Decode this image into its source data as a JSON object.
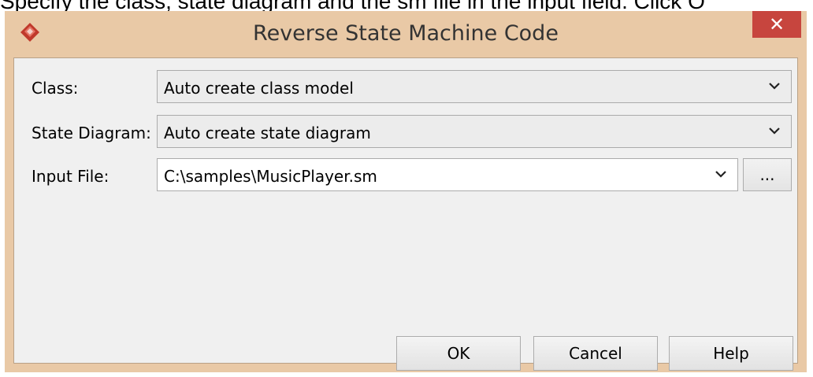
{
  "caption": "Specify the class, state diagram and the sm file in the input field. Click O",
  "window": {
    "title": "Reverse State Machine Code",
    "close_icon": "close-icon",
    "app_icon": "visual-paradigm-logo-icon"
  },
  "form": {
    "class_label": "Class:",
    "class_value": "Auto create class model",
    "state_diagram_label": "State Diagram:",
    "state_diagram_value": "Auto create state diagram",
    "input_file_label": "Input File:",
    "input_file_value": "C:\\samples\\MusicPlayer.sm",
    "browse_label": "..."
  },
  "buttons": {
    "ok": "OK",
    "cancel": "Cancel",
    "help": "Help"
  },
  "colors": {
    "frame": "#e9c9a6",
    "close_button": "#c7453e",
    "client_bg": "#f0f0f0"
  }
}
